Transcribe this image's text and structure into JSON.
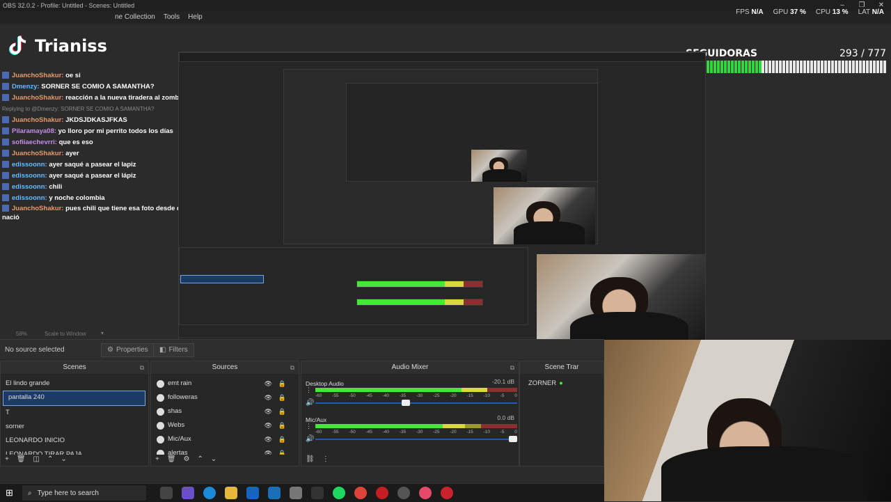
{
  "window": {
    "title": "OBS 32.0.2 - Profile: Untitled - Scenes: Untitled"
  },
  "menu": {
    "items": [
      "ne Collection",
      "Tools",
      "Help"
    ]
  },
  "stats": {
    "fps_label": "FPS",
    "fps_value": "N/A",
    "gpu_label": "GPU",
    "gpu_value": "37 %",
    "cpu_label": "CPU",
    "cpu_value": "13 %",
    "lat_label": "LAT",
    "lat_value": "N/A"
  },
  "overlay": {
    "brand": "Trianiss",
    "followers_label": "SEGUIDORAS",
    "followers_count": "293 / 777",
    "followers_progress": 0.377
  },
  "chat": [
    {
      "user": "JuanchoShakur:",
      "text": "oe si",
      "cls": "u1"
    },
    {
      "user": "Dmenzy:",
      "text": "SORNER SE COMIO A SAMANTHA?",
      "cls": "u3"
    },
    {
      "user": "JuanchoShakur:",
      "text": "reacción a la nueva tiradera al zombie",
      "cls": "u1"
    },
    {
      "reply": "Replying to @Dmenzy: SORNER SE COMIO A SAMANTHA?"
    },
    {
      "user": "JuanchoShakur:",
      "text": "JKDSJDKASJFKAS",
      "cls": "u1"
    },
    {
      "user": "Pilaramaya08:",
      "text": "yo lloro por mi perrito todos los días",
      "cls": "u2"
    },
    {
      "user": "sofiiaechevrri:",
      "text": "que es eso",
      "cls": "u2"
    },
    {
      "user": "JuanchoShakur:",
      "text": "ayer",
      "cls": "u1"
    },
    {
      "user": "edissoonn:",
      "text": "ayer saqué a pasear el lapiz",
      "cls": "u3"
    },
    {
      "user": "edissoonn:",
      "text": "ayer saqué a pasear el lápiz",
      "cls": "u3"
    },
    {
      "user": "edissoonn:",
      "text": "chili",
      "cls": "u3"
    },
    {
      "user": "edissoonn:",
      "text": "y noche colombia",
      "cls": "u3"
    },
    {
      "user": "JuanchoShakur:",
      "text": "pues chili que tiene esa foto desde que nació",
      "cls": "u1"
    }
  ],
  "zoom": {
    "level": "58%",
    "mode": "Scale to Window"
  },
  "properties_bar": {
    "no_source": "No source selected",
    "properties_label": "Properties",
    "filters_label": "Filters"
  },
  "scenes": {
    "title": "Scenes",
    "items": [
      "El lindo grande",
      "pantalla 240",
      "T",
      "sorner",
      "LEONARDO INICIO",
      "LEONARDO TIRAR PAJA"
    ],
    "selected_index": 1
  },
  "sources": {
    "title": "Sources",
    "items": [
      "emt rain",
      "followeras",
      "shas",
      "Webs",
      "Mic/Aux",
      "alertas"
    ]
  },
  "mixer": {
    "title": "Audio Mixer",
    "channels": [
      {
        "name": "Desktop Audio",
        "db": "-20.1 dB",
        "level": 0.85,
        "fader": 0.47
      },
      {
        "name": "Mic/Aux",
        "db": "0.0 dB",
        "level": 0.74,
        "fader": 1.0
      }
    ],
    "scale": [
      "-60",
      "-55",
      "-50",
      "-45",
      "-40",
      "-35",
      "-30",
      "-25",
      "-20",
      "-15",
      "-10",
      "-5",
      "0"
    ]
  },
  "scene_transitions": {
    "title": "Scene Trar",
    "item": "ZORNER"
  },
  "taskbar": {
    "search_placeholder": "Type here to search"
  }
}
